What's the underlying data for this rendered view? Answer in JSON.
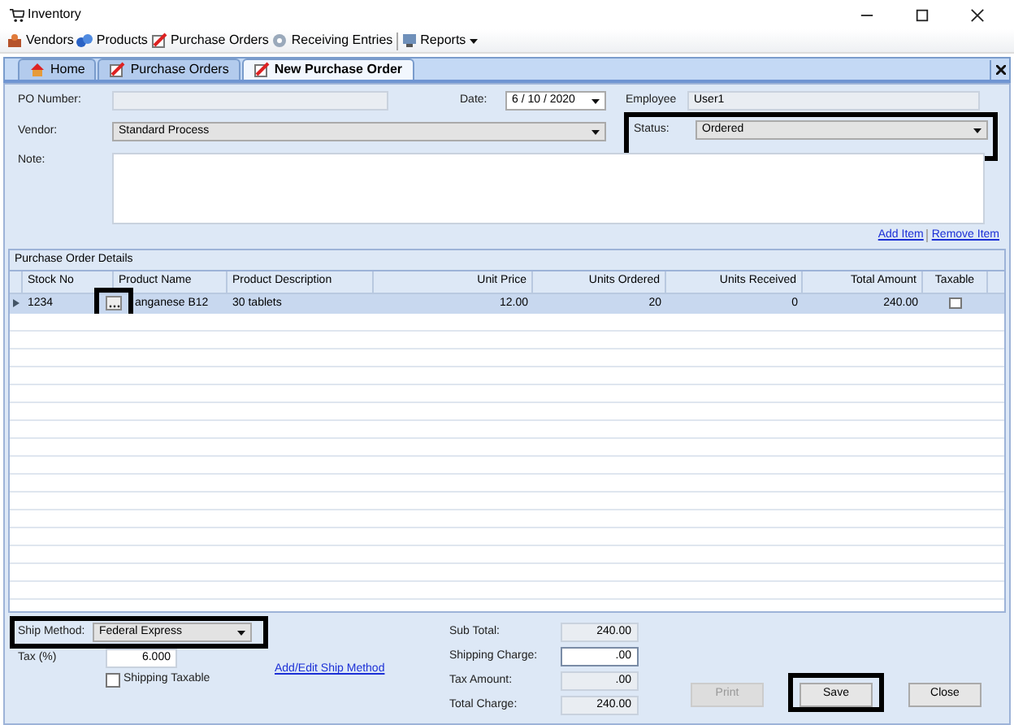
{
  "window": {
    "title": "Inventory"
  },
  "toolbar": [
    {
      "label": "Vendors",
      "kind": "vendors"
    },
    {
      "label": "Products",
      "kind": "products"
    },
    {
      "label": "Purchase Orders",
      "kind": "orders"
    },
    {
      "label": "Receiving Entries",
      "kind": "receiving"
    },
    {
      "label": "Reports",
      "kind": "reports",
      "dropdown": true
    }
  ],
  "tabs": [
    {
      "label": "Home",
      "kind": "home",
      "selected": false
    },
    {
      "label": "Purchase Orders",
      "kind": "orders",
      "selected": false
    },
    {
      "label": "New Purchase Order",
      "kind": "orders",
      "selected": true
    }
  ],
  "form": {
    "po_number": {
      "label": "PO Number:"
    },
    "date": {
      "label": "Date:",
      "value": "6 / 10 / 2020"
    },
    "employee": {
      "label": "Employee",
      "value": "User1"
    },
    "vendor": {
      "label": "Vendor:",
      "value": "Standard Process"
    },
    "status": {
      "label": "Status:",
      "value": "Ordered",
      "highlighted": true
    },
    "note": {
      "label": "Note:"
    }
  },
  "links": [
    "Add Item",
    "Remove Item"
  ],
  "details": {
    "title": "Purchase Order Details",
    "columns": [
      "Stock No",
      "Product Name",
      "Product Description",
      "Unit Price",
      "Units Ordered",
      "Units Received",
      "Total Amount",
      "Taxable"
    ],
    "rows": [
      {
        "selected": true,
        "stock_no": "1234",
        "product_name": "anganese B12",
        "picker_highlighted": true,
        "description": "30 tablets",
        "unit_price": "12.00",
        "units_ordered": "20",
        "units_received": "0",
        "total_amount": "240.00",
        "taxable": false
      }
    ]
  },
  "shipping": {
    "method_label": "Ship Method:",
    "method": "Federal Express",
    "highlighted": true,
    "tax_label": "Tax (%)",
    "tax": "6.000",
    "shipping_taxable": {
      "label": "Shipping Taxable",
      "checked": false
    },
    "link": "Add/Edit Ship Method"
  },
  "totals": [
    {
      "label": "Sub Total:",
      "value": "240.00",
      "editable": false
    },
    {
      "label": "Shipping Charge:",
      "value": ".00",
      "editable": true
    },
    {
      "label": "Tax Amount:",
      "value": ".00",
      "editable": false
    },
    {
      "label": "Total Charge:",
      "value": "240.00",
      "editable": false
    }
  ],
  "buttons": [
    {
      "label": "Print",
      "disabled": true,
      "highlighted": false
    },
    {
      "label": "Save",
      "disabled": false,
      "highlighted": true
    },
    {
      "label": "Close",
      "disabled": false,
      "highlighted": false
    }
  ]
}
